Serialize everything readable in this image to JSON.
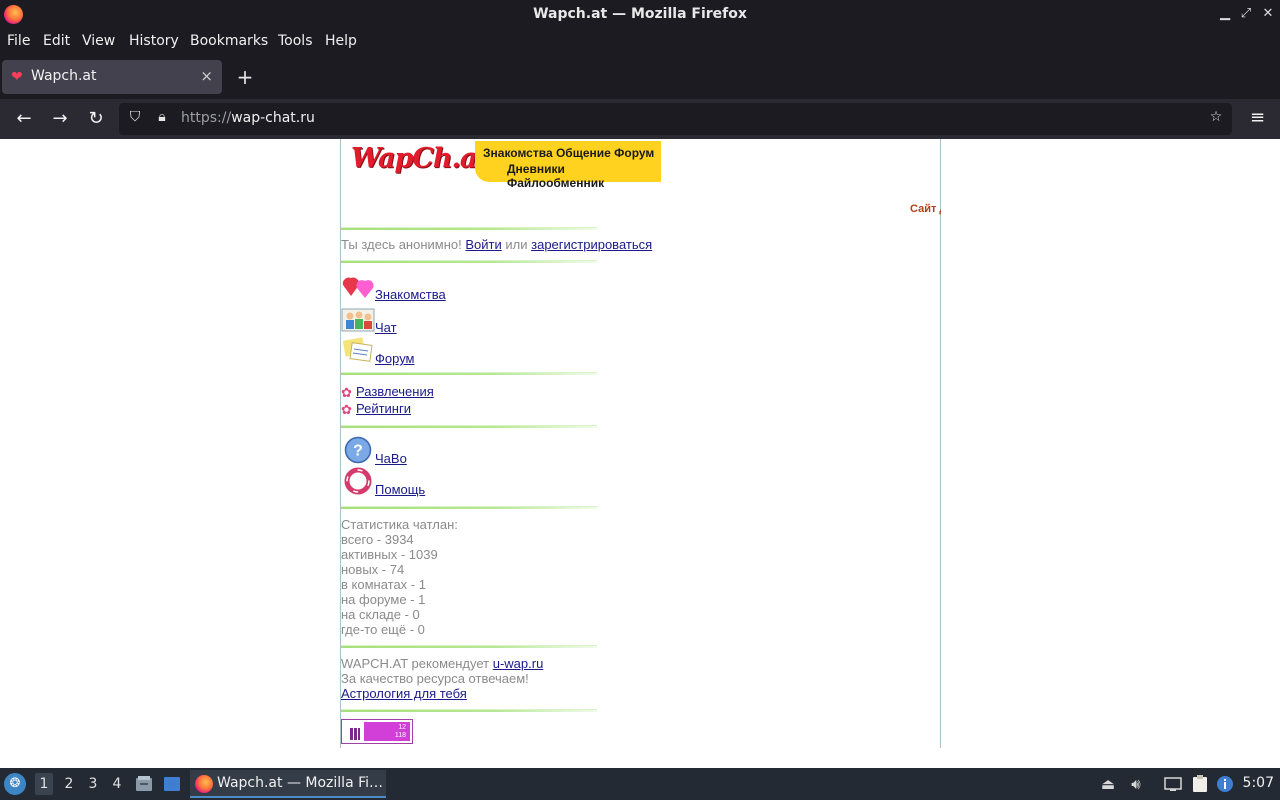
{
  "window": {
    "title": "Wapch.at — Mozilla Firefox",
    "controls": {
      "minimize": "▁",
      "restore": "⤢",
      "close": "✕"
    }
  },
  "menubar": [
    "File",
    "Edit",
    "View",
    "History",
    "Bookmarks",
    "Tools",
    "Help"
  ],
  "tab": {
    "title": "Wapch.at",
    "favicon": "heart-icon",
    "close": "×"
  },
  "newtab": "+",
  "navbar": {
    "back": "←",
    "forward": "→",
    "reload": "↻",
    "url_prefix": "https://",
    "url_host": "wap-chat.ru",
    "bookmark": "☆",
    "menu": "≡"
  },
  "page": {
    "banner": {
      "logo": "WapCh.at",
      "line1": "Знакомства Общение Форум",
      "line2": "Дневники Файлообменник"
    },
    "marquee": "Сайт д",
    "anon": {
      "text": "Ты здесь анонимно!",
      "login": "Войти",
      "or": "или",
      "register": "зарегистрироваться"
    },
    "main_links": [
      {
        "label": "Знакомства",
        "icon": "hearts-icon"
      },
      {
        "label": "Чат",
        "icon": "people-icon"
      },
      {
        "label": "Форум",
        "icon": "notes-icon"
      }
    ],
    "small_links": [
      {
        "label": "Развлечения",
        "icon": "flower-icon"
      },
      {
        "label": "Рейтинги",
        "icon": "flower-icon"
      }
    ],
    "help_links": [
      {
        "label": "ЧаВо",
        "icon": "question-icon"
      },
      {
        "label": "Помощь",
        "icon": "lifebuoy-icon"
      }
    ],
    "stats": {
      "title": "Статистика чатлан:",
      "lines": [
        "всего - 3934",
        "активных - 1039",
        "новых - 74",
        "в комнатах - 1",
        "на форуме - 1",
        "на складе - 0",
        "где-то ещё - 0"
      ]
    },
    "recommend": {
      "text": "WAPCH.AT рекомендует",
      "link": "u-wap.ru",
      "quality": "За качество ресурса отвечаем!",
      "astro": "Астрология для тебя"
    },
    "counter": {
      "line1": "12",
      "line2": "118"
    }
  },
  "taskbar": {
    "workspaces": [
      "1",
      "2",
      "3",
      "4"
    ],
    "task_title": "Wapch.at — Mozilla Fi…",
    "clock": "5:07"
  }
}
